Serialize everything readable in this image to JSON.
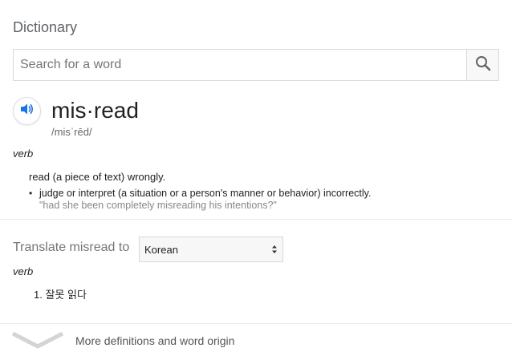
{
  "header": {
    "title": "Dictionary"
  },
  "search": {
    "placeholder": "Search for a word",
    "value": ""
  },
  "entry": {
    "word": "mis·read",
    "phonetic": "/misˈrēd/",
    "part_of_speech": "verb",
    "definition": "read (a piece of text) wrongly.",
    "sub_definition": "judge or interpret (a situation or a person's manner or behavior) incorrectly.",
    "example": "\"had she been completely misreading his intentions?\""
  },
  "translate": {
    "label": "Translate misread to",
    "selected_language": "Korean",
    "part_of_speech": "verb",
    "items": [
      "1. 잘못 읽다"
    ]
  },
  "footer": {
    "more_label": "More definitions and word origin"
  },
  "icons": {
    "search": "search-icon",
    "speaker": "speaker-icon",
    "select_arrows": "updown-arrows-icon",
    "expand": "chevron-down-icon"
  },
  "colors": {
    "accent": "#1a73e8",
    "muted": "#757575"
  }
}
